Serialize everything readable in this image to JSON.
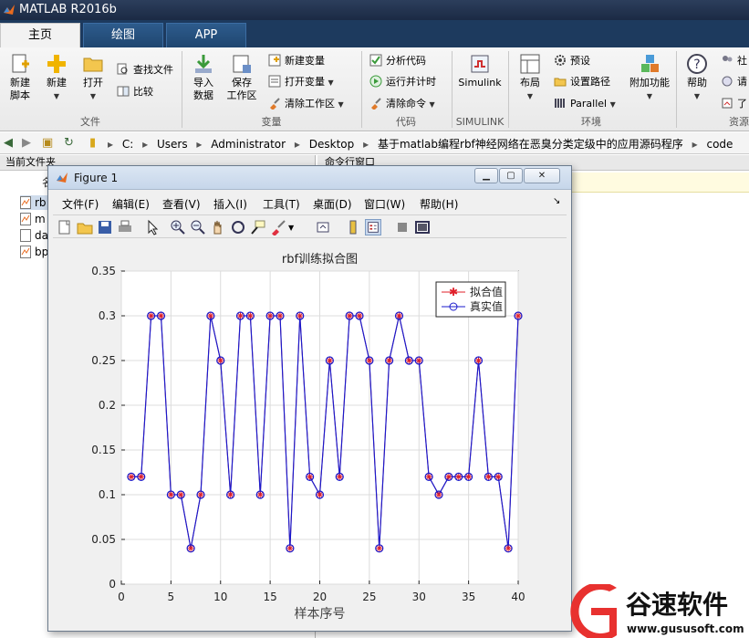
{
  "app": {
    "title": "MATLAB R2016b"
  },
  "tabs": [
    "主页",
    "绘图",
    "APP"
  ],
  "ribbon": {
    "new_script": "新建\n脚本",
    "new": "新建",
    "open": "打开",
    "find_files": "查找文件",
    "compare": "比较",
    "import_data": "导入\n数据",
    "save_workspace": "保存\n工作区",
    "new_variable": "新建变量",
    "open_variable": "打开变量",
    "clear_workspace": "清除工作区",
    "analyze_code": "分析代码",
    "run_and_time": "运行并计时",
    "clear_commands": "清除命令",
    "simulink": "Simulink",
    "layout": "布局",
    "preferences": "预设",
    "set_path": "设置路径",
    "parallel": "Parallel",
    "addons": "附加功能",
    "help": "帮助",
    "community_partial": "社",
    "request_partial": "请",
    "learn_partial": "了",
    "groups": {
      "file": "文件",
      "variable": "变量",
      "code": "代码",
      "simulink": "SIMULINK",
      "environment": "环境",
      "resources_partial": "资源"
    }
  },
  "address": {
    "segments": [
      "C:",
      "Users",
      "Administrator",
      "Desktop",
      "基于matlab编程rbf神经网络在恶臭分类定级中的应用源码程序",
      "code"
    ]
  },
  "left_panel": {
    "title": "当前文件夹",
    "column_partial": "名",
    "files": [
      "rb",
      "m",
      "da",
      "bp"
    ]
  },
  "right_panel": {
    "title": "命令行窗口"
  },
  "figure": {
    "title": "Figure 1",
    "menus": [
      "文件(F)",
      "编辑(E)",
      "查看(V)",
      "插入(I)",
      "工具(T)",
      "桌面(D)",
      "窗口(W)",
      "帮助(H)"
    ]
  },
  "colors": {
    "fit": "#e0202a",
    "actual": "#1a1acc",
    "line": "#1a1acc"
  },
  "chart_data": {
    "type": "line",
    "title": "rbf训练拟合图",
    "xlabel": "样本序号",
    "ylabel": "",
    "xlim": [
      0,
      40
    ],
    "ylim": [
      0,
      0.35
    ],
    "xticks": [
      "0",
      "5",
      "10",
      "15",
      "20",
      "25",
      "30",
      "35",
      "40"
    ],
    "yticks": [
      "0",
      "0.05",
      "0.1",
      "0.15",
      "0.2",
      "0.25",
      "0.3",
      "0.35"
    ],
    "grid": true,
    "legend_position": "top-right",
    "x": [
      1,
      2,
      3,
      4,
      5,
      6,
      7,
      8,
      9,
      10,
      11,
      12,
      13,
      14,
      15,
      16,
      17,
      18,
      19,
      20,
      21,
      22,
      23,
      24,
      25,
      26,
      27,
      28,
      29,
      30,
      31,
      32,
      33,
      34,
      35,
      36,
      37,
      38,
      39,
      40
    ],
    "series": [
      {
        "name": "拟合值",
        "marker": "*",
        "values": [
          0.12,
          0.12,
          0.3,
          0.3,
          0.1,
          0.1,
          0.04,
          0.1,
          0.3,
          0.25,
          0.1,
          0.3,
          0.3,
          0.1,
          0.3,
          0.3,
          0.04,
          0.3,
          0.12,
          0.1,
          0.25,
          0.12,
          0.3,
          0.3,
          0.25,
          0.04,
          0.25,
          0.3,
          0.25,
          0.25,
          0.12,
          0.1,
          0.12,
          0.12,
          0.12,
          0.25,
          0.12,
          0.12,
          0.04,
          0.3
        ]
      },
      {
        "name": "真实值",
        "marker": "o",
        "values": [
          0.12,
          0.12,
          0.3,
          0.3,
          0.1,
          0.1,
          0.04,
          0.1,
          0.3,
          0.25,
          0.1,
          0.3,
          0.3,
          0.1,
          0.3,
          0.3,
          0.04,
          0.3,
          0.12,
          0.1,
          0.25,
          0.12,
          0.3,
          0.3,
          0.25,
          0.04,
          0.25,
          0.3,
          0.25,
          0.25,
          0.12,
          0.1,
          0.12,
          0.12,
          0.12,
          0.25,
          0.12,
          0.12,
          0.04,
          0.3
        ]
      }
    ]
  },
  "watermark": {
    "brand": "谷速软件",
    "url": "www.gususoft.com"
  }
}
